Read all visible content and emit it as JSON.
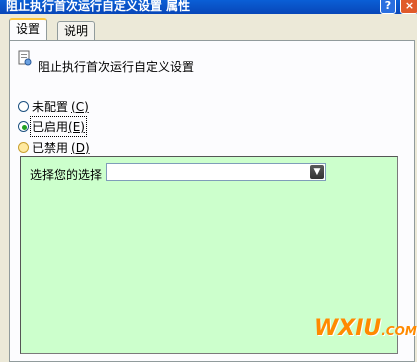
{
  "window": {
    "title": "阻止执行首次运行自定义设置 属性",
    "help_glyph": "?",
    "close_glyph": "×"
  },
  "tabs": [
    {
      "label": "设置",
      "active": true
    },
    {
      "label": "说明",
      "active": false
    }
  ],
  "policy": {
    "icon": "policy-setting-icon",
    "name": "阻止执行首次运行自定义设置"
  },
  "options": [
    {
      "label": "未配置",
      "accel": "(C)",
      "state": "unchecked"
    },
    {
      "label": "已启用",
      "accel": "(E)",
      "state": "checked"
    },
    {
      "label": "已禁用",
      "accel": "(D)",
      "state": "unchecked"
    }
  ],
  "selection": {
    "label": "选择您的选择",
    "value": ""
  },
  "watermark": {
    "text": "WXIU",
    "suffix": ".COM"
  },
  "colors": {
    "titlebar": "#0846b8",
    "panel_bg": "#fcfcfe",
    "options_bg": "#ccffcc",
    "watermark": "#ff8a00"
  }
}
